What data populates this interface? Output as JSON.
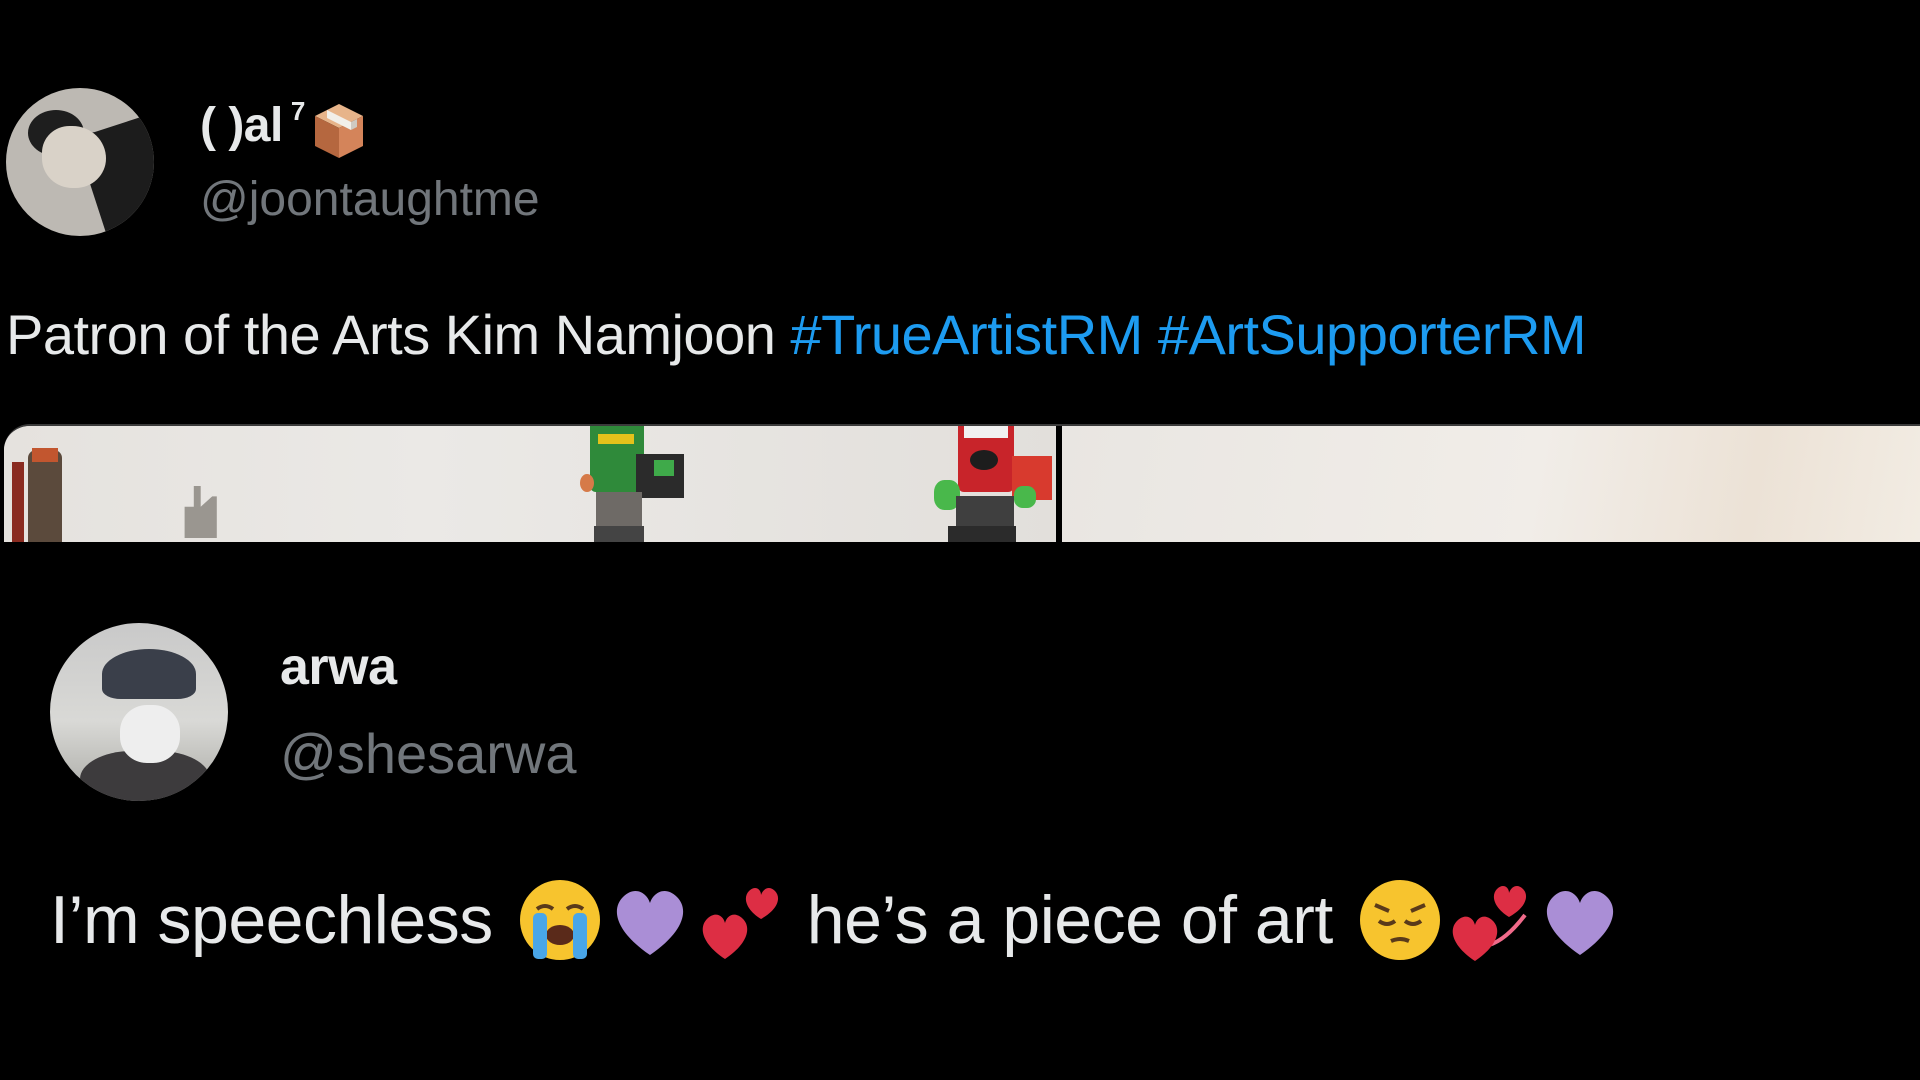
{
  "tweets": [
    {
      "display_name": "( )al",
      "name_superscript": "7",
      "name_emoji": "package-icon",
      "handle": "@joontaughtme",
      "text_plain": "Patron of the Arts Kim Namjoon ",
      "hashtags": [
        "#TrueArtistRM",
        "#ArtSupporterRM"
      ],
      "has_media": true
    },
    {
      "display_name": "arwa",
      "handle": "@shesarwa",
      "text_part1": "I’m speechless",
      "emojis_1": [
        "loudly-crying-face-icon",
        "purple-heart-icon",
        "two-hearts-icon"
      ],
      "text_part2": "he’s a piece of art",
      "emojis_2": [
        "pensive-face-icon",
        "revolving-hearts-icon",
        "purple-heart-icon"
      ]
    }
  ],
  "colors": {
    "background": "#000000",
    "text": "#e7e9ea",
    "handle": "#71767b",
    "hashtag": "#1d9bf0"
  }
}
